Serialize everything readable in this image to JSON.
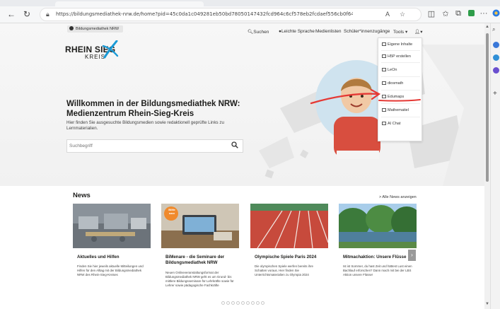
{
  "browser": {
    "url": "https://bildungsmediathek-nrw.de/home?pid=45c0da1c049281eb50bd78050147432fcd964c6cf578eb2fcdaef556cb0f6469",
    "icons": [
      "back-icon",
      "refresh-icon",
      "lock-icon",
      "read-aloud-icon",
      "favorite-icon",
      "split-screen-icon",
      "favorites-icon",
      "collections-icon",
      "extensions-icon",
      "more-icon",
      "copilot-icon"
    ]
  },
  "site": {
    "badge": "Bildungsmediathek NRW",
    "logo": {
      "line1": "RHEIN SIEG",
      "line2": "KREIS"
    }
  },
  "topnav": {
    "search": "Suchen",
    "easy_language": "Leichte Sprache",
    "media_lists": "Medienlisten",
    "student_access": "Schüler*innenzugänge",
    "tools": "Tools ▾",
    "user": "▾"
  },
  "tools_menu": [
    {
      "label": "Eigene Inhalte",
      "icon": "edit-icon"
    },
    {
      "label": "H5P erstellen",
      "icon": "plus-box-icon"
    },
    {
      "label": "LeOn",
      "icon": "list-icon"
    },
    {
      "label": "diosmath",
      "icon": "list-icon"
    },
    {
      "label": "Edumaps",
      "icon": "list-icon"
    },
    {
      "label": "Mathematiel",
      "icon": "list-icon"
    },
    {
      "label": "AI Chat",
      "icon": "chat-icon"
    }
  ],
  "hero": {
    "title_line1": "Willkommen in der Bildungsmediathek NRW:",
    "title_line2": "Medienzentrum Rhein-Sieg-Kreis",
    "subtitle": "Hier finden Sie ausgesuchte Bildungsmedien sowie redaktionell geprüfte Links zu Lernmaterialien.",
    "search_placeholder": "Suchbegriff"
  },
  "news": {
    "title": "News",
    "all_link": "> Alle News anzeigen",
    "cards": [
      {
        "title": "Aktuelles und Hilfen",
        "text": "Finden Sie hier jeweils aktuelle Mitteilungen und Hilfen für den Alltag mit der Bildungsmediathek NRW des Rhein-Sieg-Kreises"
      },
      {
        "title": "BiMenare - die Seminare der Bildungsmediathek NRW",
        "text": "Neuen Onlineveranstaltungsformat der Bildungsmediathek NRW geht es um Grund- bis mittlere Bildungsseminare für Lehrkräfte sowie für Lehrer sowie pädagogische Fachkräfte",
        "image_badge": "BiMe nare"
      },
      {
        "title": "Olympische Spiele Paris 2024",
        "text": "Die olympischen Spiele werfen bereits ihre Schatten voraus. Hier finden Sie Unterrichtsmaterialien zu Olympia 2024"
      },
      {
        "title": "Mitmachaktion: Unsere Flüsse",
        "text": "Ist ist Sommer, du hast Zeit und hättest Lust einen Bachlauf erforschen? Dann mach mit bei der LBS Aktion unsere Flüsse!"
      }
    ]
  },
  "colors": {
    "accent_red": "#e53935",
    "logo_blue": "#1a9ad6",
    "text_dark": "#1d1d1b"
  }
}
